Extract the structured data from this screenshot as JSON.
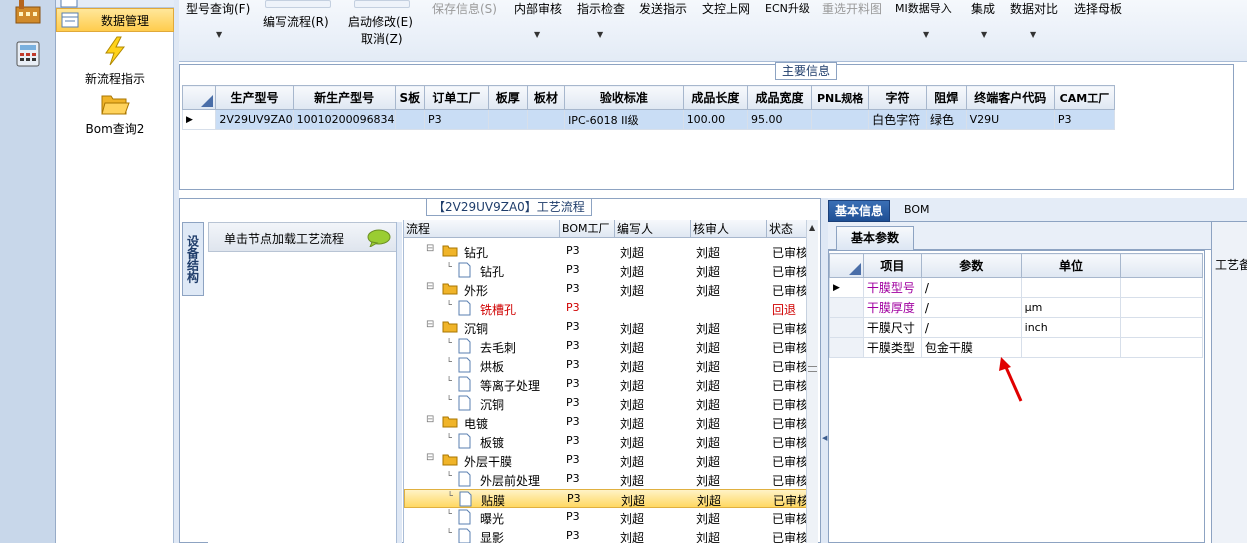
{
  "nav": {
    "mgmt_label": "数据管理",
    "items": [
      {
        "label": "新流程指示"
      },
      {
        "label": "Bom查询2"
      }
    ]
  },
  "toolbar": {
    "model_query": "型号查询(F)",
    "edit_flow": "编写流程(R)",
    "start_modify": "启动修改(E)",
    "cancel": "取消(Z)",
    "save_info": "保存信息(S)",
    "internal_review": "内部审核",
    "instruction_check": "指示检查",
    "send_instruction": "发送指示",
    "doc_upload": "文控上网",
    "ecn_upgrade": "ECN升级",
    "reselect_cut": "重选开料图",
    "mi_import": "MI数据导入",
    "integration": "集成",
    "data_compare": "数据对比",
    "select_mother": "选择母板"
  },
  "main_info": {
    "title": "主要信息",
    "columns": [
      "生产型号",
      "新生产型号",
      "S板",
      "订单工厂",
      "板厚",
      "板材",
      "验收标准",
      "成品长度",
      "成品宽度",
      "PNL规格",
      "字符",
      "阻焊",
      "终端客户代码",
      "CAM工厂"
    ],
    "row": [
      "2V29UV9ZA0",
      "10010200096834",
      "",
      "P3",
      "",
      "",
      "IPC-6018 II级",
      "100.00",
      "95.00",
      "",
      "白色字符",
      "绿色",
      "V29U",
      "P3"
    ]
  },
  "flow": {
    "title": "【2V29UV9ZA0】工艺流程",
    "vertical_tab": "设备结构",
    "load_hint": "单击节点加载工艺流程",
    "columns": [
      "流程",
      "BOM工厂",
      "编写人",
      "核审人",
      "状态"
    ],
    "rows": [
      {
        "name": "钻孔",
        "level": 0,
        "type": "folder",
        "factory": "P3",
        "writer": "刘超",
        "reviewer": "刘超",
        "status": "已审核"
      },
      {
        "name": "钻孔",
        "level": 1,
        "type": "doc",
        "factory": "P3",
        "writer": "刘超",
        "reviewer": "刘超",
        "status": "已审核"
      },
      {
        "name": "外形",
        "level": 0,
        "type": "folder",
        "factory": "P3",
        "writer": "刘超",
        "reviewer": "刘超",
        "status": "已审核"
      },
      {
        "name": "铣槽孔",
        "level": 1,
        "type": "doc",
        "factory": "P3",
        "writer": "",
        "reviewer": "",
        "status": "回退",
        "red": true
      },
      {
        "name": "沉铜",
        "level": 0,
        "type": "folder",
        "factory": "P3",
        "writer": "刘超",
        "reviewer": "刘超",
        "status": "已审核"
      },
      {
        "name": "去毛刺",
        "level": 1,
        "type": "doc",
        "factory": "P3",
        "writer": "刘超",
        "reviewer": "刘超",
        "status": "已审核"
      },
      {
        "name": "烘板",
        "level": 1,
        "type": "doc",
        "factory": "P3",
        "writer": "刘超",
        "reviewer": "刘超",
        "status": "已审核"
      },
      {
        "name": "等离子处理",
        "level": 1,
        "type": "doc",
        "factory": "P3",
        "writer": "刘超",
        "reviewer": "刘超",
        "status": "已审核"
      },
      {
        "name": "沉铜",
        "level": 1,
        "type": "doc",
        "factory": "P3",
        "writer": "刘超",
        "reviewer": "刘超",
        "status": "已审核"
      },
      {
        "name": "电镀",
        "level": 0,
        "type": "folder",
        "factory": "P3",
        "writer": "刘超",
        "reviewer": "刘超",
        "status": "已审核"
      },
      {
        "name": "板镀",
        "level": 1,
        "type": "doc",
        "factory": "P3",
        "writer": "刘超",
        "reviewer": "刘超",
        "status": "已审核"
      },
      {
        "name": "外层干膜",
        "level": 0,
        "type": "folder",
        "factory": "P3",
        "writer": "刘超",
        "reviewer": "刘超",
        "status": "已审核"
      },
      {
        "name": "外层前处理",
        "level": 1,
        "type": "doc",
        "factory": "P3",
        "writer": "刘超",
        "reviewer": "刘超",
        "status": "已审核"
      },
      {
        "name": "贴膜",
        "level": 1,
        "type": "doc",
        "factory": "P3",
        "writer": "刘超",
        "reviewer": "刘超",
        "status": "已审核",
        "highlight": true
      },
      {
        "name": "曝光",
        "level": 1,
        "type": "doc",
        "factory": "P3",
        "writer": "刘超",
        "reviewer": "刘超",
        "status": "已审核"
      },
      {
        "name": "显影",
        "level": 1,
        "type": "doc",
        "factory": "P3",
        "writer": "刘超",
        "reviewer": "刘超",
        "status": "已审核"
      }
    ]
  },
  "right": {
    "tab_basic": "基本信息",
    "tab_bom": "BOM",
    "subtab": "基本参数",
    "far_right_label": "工艺备",
    "param_columns": [
      "项目",
      "参数",
      "单位"
    ],
    "params": [
      {
        "item": "干膜型号",
        "value": "/",
        "unit": "",
        "pink": true
      },
      {
        "item": "干膜厚度",
        "value": "/",
        "unit": "μm",
        "pink": true
      },
      {
        "item": "干膜尺寸",
        "value": "/",
        "unit": "inch",
        "pink": false
      },
      {
        "item": "干膜类型",
        "value": "包金干膜",
        "unit": "",
        "pink": false
      }
    ]
  },
  "colors": {
    "highlight_row": "#ffd862",
    "selected_row": "#c9ddf5",
    "active_tab": "#1e4f94",
    "annotation_arrow": "#e00000"
  }
}
